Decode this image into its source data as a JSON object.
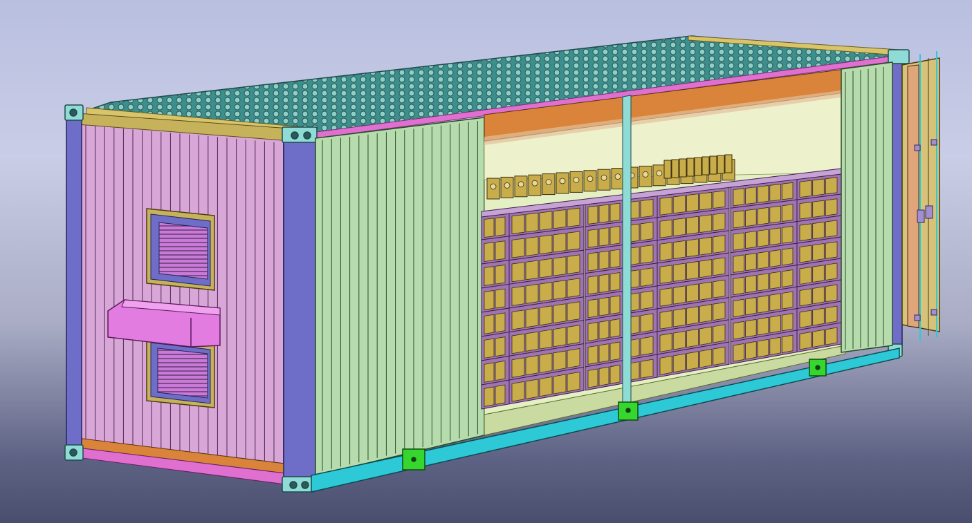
{
  "viewport": {
    "background_top": "#b9bfe0",
    "background_bottom": "#4a4e6e"
  },
  "model": {
    "kind": "cutaway 3D CAD render of a shipping container with battery racks",
    "colors": {
      "roof": "#3c8f8c",
      "end_wall": "#d9a6d8",
      "side_wall": "#b6dcae",
      "corner_post": "#6e6ec8",
      "corner_casting": "#8fdcd6",
      "bottom_rail": "#2ec9d6",
      "top_rail": "#e070d0",
      "header_beam": "#d9843a",
      "battery_rack": "#a074b0",
      "battery_cell": "#c8ad4a",
      "forklift_pocket": "#36d62e",
      "louver_vent": "#c97ad8",
      "ac_unit": "#e27ce0",
      "door": "#d6c278"
    }
  }
}
